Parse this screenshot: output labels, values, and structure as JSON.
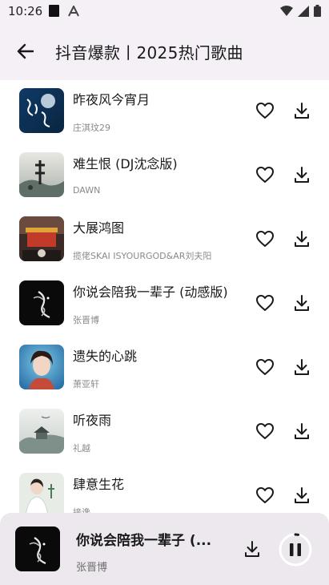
{
  "status_bar": {
    "time": "10:26",
    "icons": [
      "square-notification-icon",
      "font-a-icon",
      "wifi-icon",
      "signal-icon",
      "battery-icon"
    ]
  },
  "app_bar": {
    "back_icon": "arrow-left-icon",
    "title": "抖音爆款丨2025热门歌曲"
  },
  "songs": [
    {
      "title": "昨夜风今宵月",
      "artist": "庄淇玟29"
    },
    {
      "title": "难生恨 (DJ沈念版)",
      "artist": "DAWN"
    },
    {
      "title": "大展鸿图",
      "artist": "揽佬SKAI ISYOURGOD&AR刘夫阳"
    },
    {
      "title": "你说会陪我一辈子 (动感版)",
      "artist": "张晋博"
    },
    {
      "title": "遗失的心跳",
      "artist": "萧亚轩"
    },
    {
      "title": "听夜雨",
      "artist": "礼越"
    },
    {
      "title": "肆意生花",
      "artist": "接谗"
    }
  ],
  "row_actions": {
    "like_icon": "heart-outline-icon",
    "download_icon": "download-icon"
  },
  "now_playing": {
    "title": "你说会陪我一辈子 (...",
    "artist": "张晋博",
    "download_icon": "download-icon",
    "control_icon": "pause-icon",
    "progress": 0.03
  },
  "colors": {
    "header_bg": "#f4f0f6",
    "player_bg": "#ece8ee",
    "artist_text": "#8a8a8a",
    "icon": "#1a1a1a"
  }
}
